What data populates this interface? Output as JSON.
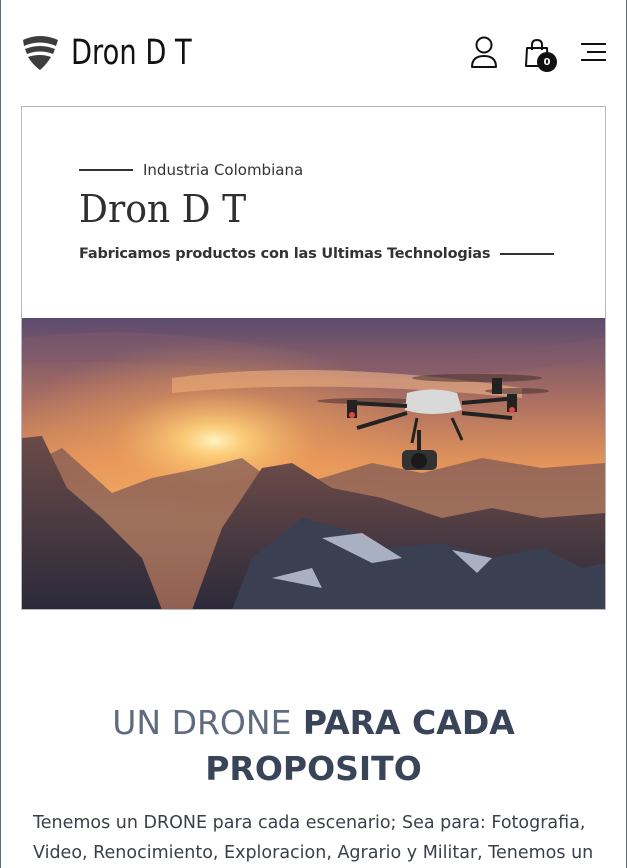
{
  "header": {
    "brand": "Dron D T",
    "cart_count": "0",
    "icons": {
      "logo": "shield-logo-icon",
      "account": "user-icon",
      "cart": "shopping-bag-icon",
      "menu": "hamburger-menu-icon"
    }
  },
  "hero": {
    "kicker": "Industria Colombiana",
    "title": "Dron D T",
    "tagline": "Fabricamos productos con las Ultimas Technologias",
    "image_alt": "drone-over-mountains-at-sunset"
  },
  "section": {
    "title_light": "UN DRONE",
    "title_bold": "PARA CADA PROPOSITO",
    "body": "Tenemos un DRONE para cada escenario; Sea para: Fotografia, Video, Renocimiento, Exploracion, Agrario y Militar, Tenemos un"
  },
  "colors": {
    "title_dark": "#3a4459",
    "title_light": "#5f6b7e",
    "text": "#333333",
    "frame_border": "#5a6b85"
  }
}
